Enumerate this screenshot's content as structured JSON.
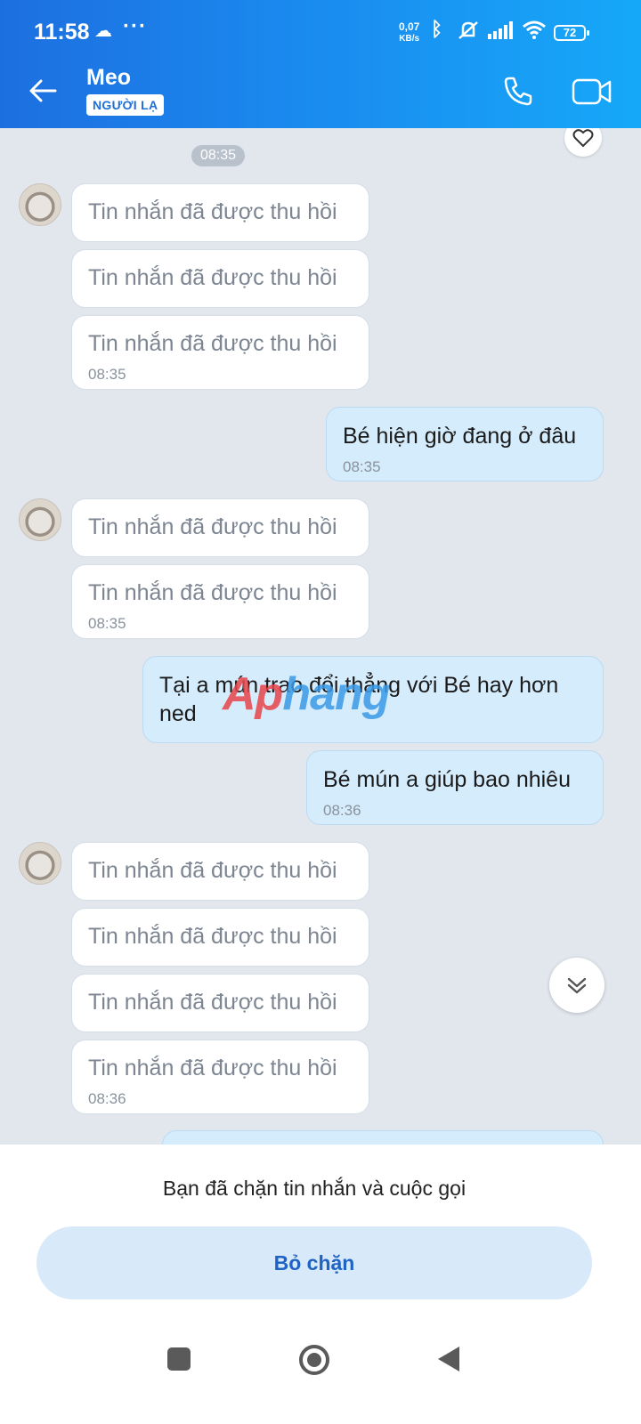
{
  "status_bar": {
    "time": "11:58",
    "net_speed_value": "0,07",
    "net_speed_unit": "KB/s",
    "battery": "72"
  },
  "header": {
    "contact_name": "Meo",
    "badge": "NGƯỜI LẠ"
  },
  "messages": {
    "time_divider": "08:35",
    "recalled_text": "Tin nhắn đã được thu hồi",
    "group1_ts": "08:35",
    "out1_text": "Bé hiện giờ đang ở đâu",
    "out1_ts": "08:35",
    "group2_ts": "08:35",
    "out2_text": "Tại a mún trao đổi thẳng với Bé hay hơn ned",
    "out3_text": "Bé mún a giúp bao nhiêu",
    "out3_ts": "08:36",
    "group3_ts": "08:36"
  },
  "watermark": {
    "part1": "Ap",
    "part2": "hang"
  },
  "bottom": {
    "blocked_notice": "Bạn đã chặn tin nhắn và cuộc gọi",
    "unblock_label": "Bỏ chặn"
  },
  "icons": [
    "back-arrow-icon",
    "phone-icon",
    "video-camera-icon",
    "heart-icon",
    "chevron-double-down-icon",
    "cloud-icon",
    "bluetooth-icon",
    "mute-icon",
    "signal-icon",
    "wifi-icon"
  ],
  "colors": {
    "header_gradient_start": "#1d6fe0",
    "header_gradient_end": "#16a8f8",
    "outgoing_bubble": "#d5ecfc",
    "unblock_button": "#d8e9fa",
    "unblock_text": "#1f63c5"
  }
}
